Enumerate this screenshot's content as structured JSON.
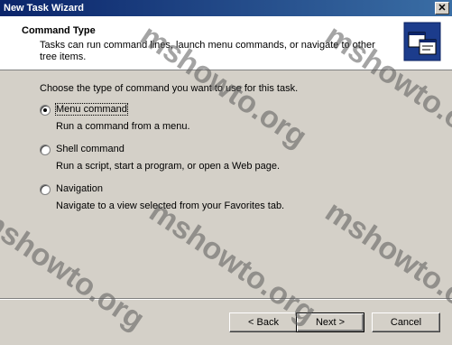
{
  "window": {
    "title": "New Task Wizard",
    "close_glyph": "✕"
  },
  "header": {
    "title": "Command Type",
    "description": "Tasks can run command lines, launch menu commands, or navigate to other tree items.",
    "icon": "wizard-windows-icon"
  },
  "main": {
    "prompt": "Choose the type of command you want to use for this task.",
    "options": [
      {
        "label": "Menu command",
        "description": "Run a command from a menu.",
        "selected": true
      },
      {
        "label": "Shell command",
        "description": "Run a script, start a program, or open a Web page.",
        "selected": false
      },
      {
        "label": "Navigation",
        "description": "Navigate to a view selected from your Favorites tab.",
        "selected": false
      }
    ]
  },
  "buttons": {
    "back": "< Back",
    "next": "Next >",
    "cancel": "Cancel"
  },
  "watermark": {
    "text": "mshowto.org"
  }
}
